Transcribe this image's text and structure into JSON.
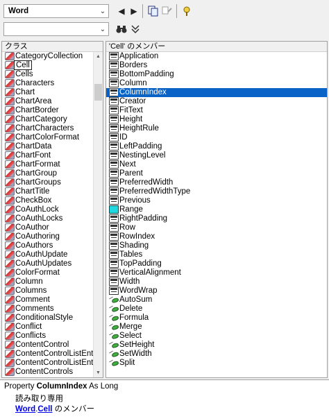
{
  "toolbar": {
    "library_value": "Word",
    "search_value": ""
  },
  "classes_header": "クラス",
  "classes": [
    "CategoryCollection",
    "Cell",
    "Cells",
    "Characters",
    "Chart",
    "ChartArea",
    "ChartBorder",
    "ChartCategory",
    "ChartCharacters",
    "ChartColorFormat",
    "ChartData",
    "ChartFont",
    "ChartFormat",
    "ChartGroup",
    "ChartGroups",
    "ChartTitle",
    "CheckBox",
    "CoAuthLock",
    "CoAuthLocks",
    "CoAuthor",
    "CoAuthoring",
    "CoAuthors",
    "CoAuthUpdate",
    "CoAuthUpdates",
    "ColorFormat",
    "Column",
    "Columns",
    "Comment",
    "Comments",
    "ConditionalStyle",
    "Conflict",
    "Conflicts",
    "ContentControl",
    "ContentControlListEnt",
    "ContentControlListEnt",
    "ContentControls"
  ],
  "selected_class_index": 1,
  "members_header": "'Cell' のメンバー",
  "members": [
    {
      "name": "Application",
      "kind": "property"
    },
    {
      "name": "Borders",
      "kind": "property"
    },
    {
      "name": "BottomPadding",
      "kind": "property"
    },
    {
      "name": "Column",
      "kind": "property"
    },
    {
      "name": "ColumnIndex",
      "kind": "property"
    },
    {
      "name": "Creator",
      "kind": "property"
    },
    {
      "name": "FitText",
      "kind": "property"
    },
    {
      "name": "Height",
      "kind": "property"
    },
    {
      "name": "HeightRule",
      "kind": "property"
    },
    {
      "name": "ID",
      "kind": "property"
    },
    {
      "name": "LeftPadding",
      "kind": "property"
    },
    {
      "name": "NestingLevel",
      "kind": "property"
    },
    {
      "name": "Next",
      "kind": "property"
    },
    {
      "name": "Parent",
      "kind": "property"
    },
    {
      "name": "PreferredWidth",
      "kind": "property"
    },
    {
      "name": "PreferredWidthType",
      "kind": "property"
    },
    {
      "name": "Previous",
      "kind": "property"
    },
    {
      "name": "Range",
      "kind": "default-property"
    },
    {
      "name": "RightPadding",
      "kind": "property"
    },
    {
      "name": "Row",
      "kind": "property"
    },
    {
      "name": "RowIndex",
      "kind": "property"
    },
    {
      "name": "Shading",
      "kind": "property"
    },
    {
      "name": "Tables",
      "kind": "property"
    },
    {
      "name": "TopPadding",
      "kind": "property"
    },
    {
      "name": "VerticalAlignment",
      "kind": "property"
    },
    {
      "name": "Width",
      "kind": "property"
    },
    {
      "name": "WordWrap",
      "kind": "property"
    },
    {
      "name": "AutoSum",
      "kind": "method"
    },
    {
      "name": "Delete",
      "kind": "method"
    },
    {
      "name": "Formula",
      "kind": "method"
    },
    {
      "name": "Merge",
      "kind": "method"
    },
    {
      "name": "Select",
      "kind": "method"
    },
    {
      "name": "SetHeight",
      "kind": "method"
    },
    {
      "name": "SetWidth",
      "kind": "method"
    },
    {
      "name": "Split",
      "kind": "method"
    }
  ],
  "selected_member_index": 4,
  "detail": {
    "line1_prefix": "Property ",
    "line1_name": "ColumnIndex",
    "line1_suffix": " As Long",
    "line2": "読み取り専用",
    "line3_lib": "Word",
    "line3_dot": ".",
    "line3_class": "Cell",
    "line3_suffix": " のメンバー"
  },
  "colors": {
    "selection": "#0a64c8",
    "link": "#0000ee"
  }
}
